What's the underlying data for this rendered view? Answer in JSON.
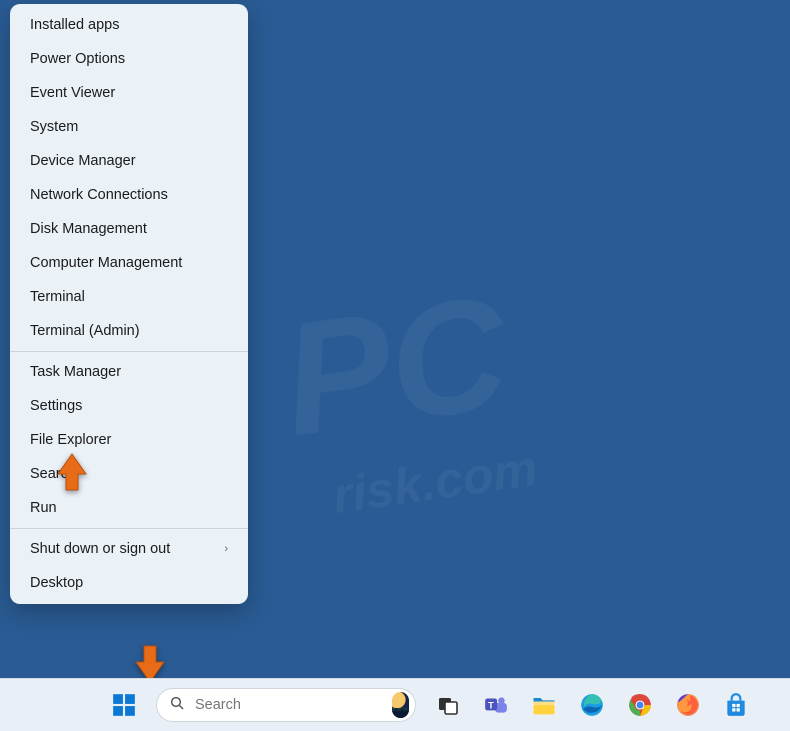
{
  "context_menu": {
    "groups": [
      [
        {
          "label": "Installed apps",
          "key": "installed-apps"
        },
        {
          "label": "Power Options",
          "key": "power-options"
        },
        {
          "label": "Event Viewer",
          "key": "event-viewer"
        },
        {
          "label": "System",
          "key": "system"
        },
        {
          "label": "Device Manager",
          "key": "device-manager"
        },
        {
          "label": "Network Connections",
          "key": "network-connections"
        },
        {
          "label": "Disk Management",
          "key": "disk-management"
        },
        {
          "label": "Computer Management",
          "key": "computer-management"
        },
        {
          "label": "Terminal",
          "key": "terminal"
        },
        {
          "label": "Terminal (Admin)",
          "key": "terminal-admin"
        }
      ],
      [
        {
          "label": "Task Manager",
          "key": "task-manager"
        },
        {
          "label": "Settings",
          "key": "settings"
        },
        {
          "label": "File Explorer",
          "key": "file-explorer"
        },
        {
          "label": "Search",
          "key": "search"
        },
        {
          "label": "Run",
          "key": "run"
        }
      ],
      [
        {
          "label": "Shut down or sign out",
          "key": "shutdown",
          "submenu": true
        },
        {
          "label": "Desktop",
          "key": "desktop"
        }
      ]
    ]
  },
  "search": {
    "placeholder": "Search"
  },
  "taskbar": {
    "icons": [
      {
        "name": "task-view-icon"
      },
      {
        "name": "teams-icon"
      },
      {
        "name": "file-explorer-icon"
      },
      {
        "name": "edge-icon"
      },
      {
        "name": "chrome-icon"
      },
      {
        "name": "firefox-icon"
      },
      {
        "name": "store-icon"
      }
    ]
  },
  "watermark": {
    "main": "PC",
    "sub": "risk.com"
  },
  "colors": {
    "accent": "#e86c18",
    "desktop": "#2a5b94",
    "menu_bg": "#eaf1f7",
    "taskbar_bg": "#e9eff6"
  }
}
